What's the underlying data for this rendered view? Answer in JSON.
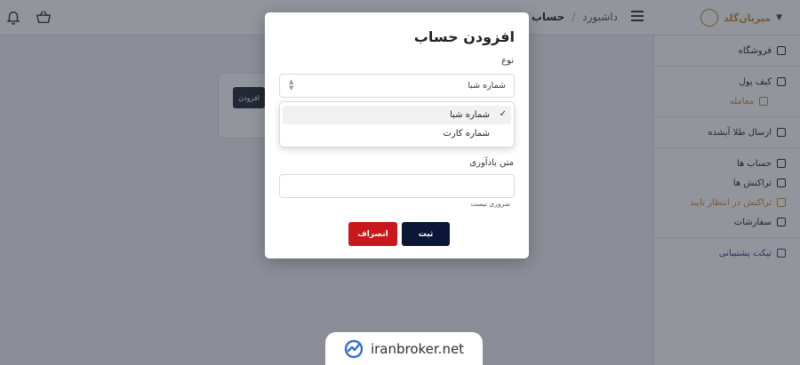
{
  "header": {
    "brand_name": "میریان‌گلد",
    "breadcrumb": {
      "home": "داشبورد",
      "current": "حساب ها"
    }
  },
  "sidebar": {
    "items": [
      {
        "label": "فروشگاه",
        "icon": "store-icon"
      },
      {
        "label": "کیف پول",
        "icon": "wallet-icon"
      },
      {
        "label": "معامله",
        "icon": "trade-icon"
      },
      {
        "label": "ارسال طلا آبشده",
        "icon": "truck-icon"
      },
      {
        "label": "حساب ها",
        "icon": "card-icon"
      },
      {
        "label": "تراکنش ها",
        "icon": "receipt-icon"
      },
      {
        "label": "تراکنش در انتظار تایید",
        "icon": "pending-icon"
      },
      {
        "label": "سفارشات",
        "icon": "orders-icon"
      },
      {
        "label": "تیکت پشتیبانی",
        "icon": "chat-icon"
      }
    ]
  },
  "main": {
    "add_button": "افزودن"
  },
  "modal": {
    "title": "افزودن حساب",
    "type_label": "نوع",
    "type_value": "شماره شبا",
    "options": [
      "شماره شبا",
      "شماره کارت"
    ],
    "note_label": "متن یادآوری",
    "note_value": "",
    "note_hint": "ضروری نیست",
    "submit": "ثبت",
    "cancel": "انصراف"
  },
  "watermark": {
    "text": "iranbroker.net"
  },
  "colors": {
    "primary": "#0c1637",
    "danger": "#c8181d",
    "gold": "#c28a2e"
  }
}
